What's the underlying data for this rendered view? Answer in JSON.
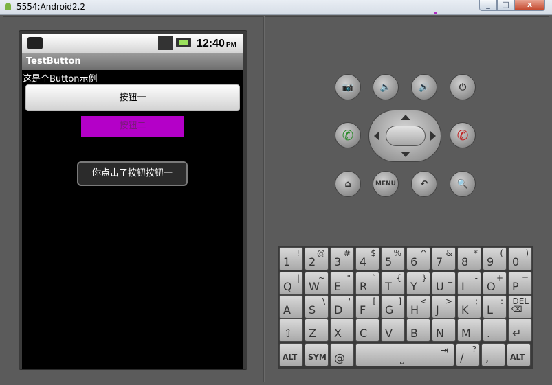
{
  "window": {
    "title": "5554:Android2.2",
    "minimize": "_",
    "maximize": "□",
    "close": "x"
  },
  "statusbar": {
    "time": "12:40",
    "ampm": "PM"
  },
  "app": {
    "title": "TestButton",
    "hint": "这是个Button示例",
    "button1": "按钮一",
    "button2": "按钮二",
    "toast": "你点击了按钮按钮一"
  },
  "controls": {
    "camera": "📷",
    "vol_down": "🔈",
    "vol_up": "🔊",
    "power": "⏻",
    "call": "✆",
    "end": "✆",
    "home": "⌂",
    "menu": "MENU",
    "back": "↶",
    "search": "🔍"
  },
  "keyboard": {
    "rows": [
      [
        {
          "main": "1",
          "alt": "!"
        },
        {
          "main": "2",
          "alt": "@"
        },
        {
          "main": "3",
          "alt": "#"
        },
        {
          "main": "4",
          "alt": "$"
        },
        {
          "main": "5",
          "alt": "%"
        },
        {
          "main": "6",
          "alt": "^"
        },
        {
          "main": "7",
          "alt": "&"
        },
        {
          "main": "8",
          "alt": "*"
        },
        {
          "main": "9",
          "alt": "("
        },
        {
          "main": "0",
          "alt": ")"
        }
      ],
      [
        {
          "main": "Q",
          "alt": "|"
        },
        {
          "main": "W",
          "alt": "~"
        },
        {
          "main": "E",
          "alt": "\""
        },
        {
          "main": "R",
          "alt": "`"
        },
        {
          "main": "T",
          "alt": "{"
        },
        {
          "main": "Y",
          "alt": "}"
        },
        {
          "main": "U",
          "alt": "_"
        },
        {
          "main": "I",
          "alt": "-"
        },
        {
          "main": "O",
          "alt": "+"
        },
        {
          "main": "P",
          "alt": "="
        }
      ],
      [
        {
          "main": "A",
          "alt": ""
        },
        {
          "main": "S",
          "alt": "\\"
        },
        {
          "main": "D",
          "alt": "'"
        },
        {
          "main": "F",
          "alt": "["
        },
        {
          "main": "G",
          "alt": "]"
        },
        {
          "main": "H",
          "alt": "<"
        },
        {
          "main": "J",
          "alt": ">"
        },
        {
          "main": "K",
          "alt": ";"
        },
        {
          "main": "L",
          "alt": ":"
        },
        {
          "main": "⌫",
          "alt": "DEL"
        }
      ],
      [
        {
          "main": "⇧",
          "alt": ""
        },
        {
          "main": "Z",
          "alt": ""
        },
        {
          "main": "X",
          "alt": ""
        },
        {
          "main": "C",
          "alt": ""
        },
        {
          "main": "V",
          "alt": ""
        },
        {
          "main": "B",
          "alt": ""
        },
        {
          "main": "N",
          "alt": ""
        },
        {
          "main": "M",
          "alt": ""
        },
        {
          "main": ".",
          "alt": ""
        },
        {
          "main": "↵",
          "alt": ""
        }
      ],
      [
        {
          "main": "ALT",
          "alt": ""
        },
        {
          "main": "SYM",
          "alt": ""
        },
        {
          "main": "@",
          "alt": ""
        },
        {
          "main": "⎵",
          "alt": "⇥"
        },
        {
          "main": "/",
          "alt": "?"
        },
        {
          "main": ",",
          "alt": ""
        },
        {
          "main": "ALT",
          "alt": ""
        }
      ]
    ]
  }
}
